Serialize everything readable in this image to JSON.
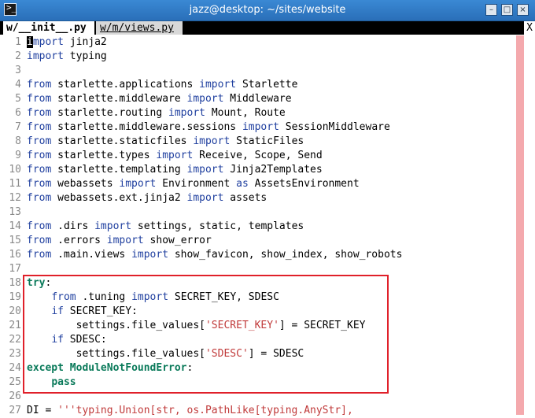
{
  "window": {
    "title": "jazz@desktop: ~/sites/website",
    "app_icon_glyph": ">_",
    "buttons": {
      "minimize": "–",
      "maximize": "□",
      "close": "×"
    }
  },
  "tabs": [
    {
      "label": "w/__init__.py",
      "active": true
    },
    {
      "label": "w/m/views.py",
      "active": false
    }
  ],
  "tab_close_label": "X",
  "editor": {
    "lines": [
      {
        "n": "1",
        "segs": [
          {
            "t": "i",
            "c": "cursor"
          },
          {
            "t": "mport",
            "c": "kw"
          },
          {
            "t": " jinja2"
          }
        ]
      },
      {
        "n": "2",
        "segs": [
          {
            "t": "import",
            "c": "kw"
          },
          {
            "t": " typing"
          }
        ]
      },
      {
        "n": "3",
        "segs": []
      },
      {
        "n": "4",
        "segs": [
          {
            "t": "from",
            "c": "kw"
          },
          {
            "t": " starlette.applications "
          },
          {
            "t": "import",
            "c": "kw"
          },
          {
            "t": " Starlette"
          }
        ]
      },
      {
        "n": "5",
        "segs": [
          {
            "t": "from",
            "c": "kw"
          },
          {
            "t": " starlette.middleware "
          },
          {
            "t": "import",
            "c": "kw"
          },
          {
            "t": " Middleware"
          }
        ]
      },
      {
        "n": "6",
        "segs": [
          {
            "t": "from",
            "c": "kw"
          },
          {
            "t": " starlette.routing "
          },
          {
            "t": "import",
            "c": "kw"
          },
          {
            "t": " Mount, Route"
          }
        ]
      },
      {
        "n": "7",
        "segs": [
          {
            "t": "from",
            "c": "kw"
          },
          {
            "t": " starlette.middleware.sessions "
          },
          {
            "t": "import",
            "c": "kw"
          },
          {
            "t": " SessionMiddleware"
          }
        ]
      },
      {
        "n": "8",
        "segs": [
          {
            "t": "from",
            "c": "kw"
          },
          {
            "t": " starlette.staticfiles "
          },
          {
            "t": "import",
            "c": "kw"
          },
          {
            "t": " StaticFiles"
          }
        ]
      },
      {
        "n": "9",
        "segs": [
          {
            "t": "from",
            "c": "kw"
          },
          {
            "t": " starlette.types "
          },
          {
            "t": "import",
            "c": "kw"
          },
          {
            "t": " Receive, Scope, Send"
          }
        ]
      },
      {
        "n": "10",
        "segs": [
          {
            "t": "from",
            "c": "kw"
          },
          {
            "t": " starlette.templating "
          },
          {
            "t": "import",
            "c": "kw"
          },
          {
            "t": " Jinja2Templates"
          }
        ]
      },
      {
        "n": "11",
        "segs": [
          {
            "t": "from",
            "c": "kw"
          },
          {
            "t": " webassets "
          },
          {
            "t": "import",
            "c": "kw"
          },
          {
            "t": " Environment "
          },
          {
            "t": "as",
            "c": "kw"
          },
          {
            "t": " AssetsEnvironment"
          }
        ]
      },
      {
        "n": "12",
        "segs": [
          {
            "t": "from",
            "c": "kw"
          },
          {
            "t": " webassets.ext.jinja2 "
          },
          {
            "t": "import",
            "c": "kw"
          },
          {
            "t": " assets"
          }
        ]
      },
      {
        "n": "13",
        "segs": []
      },
      {
        "n": "14",
        "segs": [
          {
            "t": "from",
            "c": "kw"
          },
          {
            "t": " .dirs "
          },
          {
            "t": "import",
            "c": "kw"
          },
          {
            "t": " settings, static, templates"
          }
        ]
      },
      {
        "n": "15",
        "segs": [
          {
            "t": "from",
            "c": "kw"
          },
          {
            "t": " .errors "
          },
          {
            "t": "import",
            "c": "kw"
          },
          {
            "t": " show_error"
          }
        ]
      },
      {
        "n": "16",
        "segs": [
          {
            "t": "from",
            "c": "kw"
          },
          {
            "t": " .main.views "
          },
          {
            "t": "import",
            "c": "kw"
          },
          {
            "t": " show_favicon, show_index, show_robots"
          }
        ]
      },
      {
        "n": "17",
        "segs": []
      },
      {
        "n": "18",
        "segs": [
          {
            "t": "try",
            "c": "kw2"
          },
          {
            "t": ":"
          }
        ]
      },
      {
        "n": "19",
        "segs": [
          {
            "t": "    "
          },
          {
            "t": "from",
            "c": "kw"
          },
          {
            "t": " .tuning "
          },
          {
            "t": "import",
            "c": "kw"
          },
          {
            "t": " SECRET_KEY, SDESC"
          }
        ]
      },
      {
        "n": "20",
        "segs": [
          {
            "t": "    "
          },
          {
            "t": "if",
            "c": "kw"
          },
          {
            "t": " SECRET_KEY:"
          }
        ]
      },
      {
        "n": "21",
        "segs": [
          {
            "t": "        settings.file_values["
          },
          {
            "t": "'SECRET_KEY'",
            "c": "str"
          },
          {
            "t": "] = SECRET_KEY"
          }
        ]
      },
      {
        "n": "22",
        "segs": [
          {
            "t": "    "
          },
          {
            "t": "if",
            "c": "kw"
          },
          {
            "t": " SDESC:"
          }
        ]
      },
      {
        "n": "23",
        "segs": [
          {
            "t": "        settings.file_values["
          },
          {
            "t": "'SDESC'",
            "c": "str"
          },
          {
            "t": "] = SDESC"
          }
        ]
      },
      {
        "n": "24",
        "segs": [
          {
            "t": "except",
            "c": "kw2"
          },
          {
            "t": " "
          },
          {
            "t": "ModuleNotFoundError",
            "c": "cls"
          },
          {
            "t": ":"
          }
        ]
      },
      {
        "n": "25",
        "segs": [
          {
            "t": "    "
          },
          {
            "t": "pass",
            "c": "kw2"
          }
        ]
      },
      {
        "n": "26",
        "segs": []
      },
      {
        "n": "27",
        "segs": [
          {
            "t": "DI = "
          },
          {
            "t": "'''typing.Union[str, os.PathLike[typing.AnyStr],",
            "c": "str"
          }
        ]
      }
    ]
  },
  "colors": {
    "titlebar": "#2a6fb8",
    "keyword": "#1f3f9f",
    "keyword_flow": "#0a7a5a",
    "string": "#c03a3a",
    "highlight_box": "#e0202a",
    "color_column": "#f4a9ad"
  }
}
